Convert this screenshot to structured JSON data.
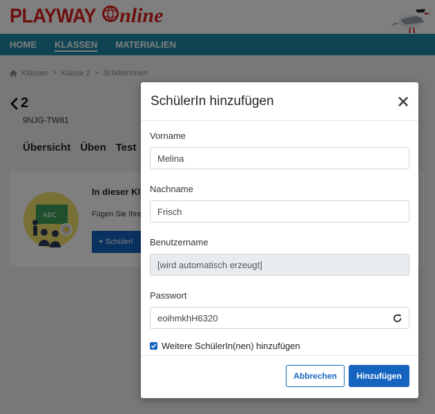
{
  "header": {
    "logo_playway": "PLAYWAY",
    "logo_online": "nline"
  },
  "nav": {
    "items": [
      {
        "label": "HOME"
      },
      {
        "label": "KLASSEN"
      },
      {
        "label": "MATERIALIEN"
      }
    ],
    "active_index": 1
  },
  "breadcrumb": {
    "items": [
      "Klassen",
      "Klasse 2",
      "SchülerInnen"
    ],
    "separator": ">"
  },
  "class_view": {
    "title": "2",
    "code": "9NJG-TW81",
    "tabs": [
      "Übersicht",
      "Üben",
      "Test"
    ],
    "card": {
      "title": "In dieser Kl",
      "text": "Fügen Sie Ihre",
      "button_label": "Schülerl"
    }
  },
  "modal": {
    "title": "SchülerIn hinzufügen",
    "fields": {
      "vorname": {
        "label": "Vorname",
        "value": "Melina"
      },
      "nachname": {
        "label": "Nachname",
        "value": "Frisch"
      },
      "benutzername": {
        "label": "Benutzername",
        "value": "[wird automatisch erzeugt]"
      },
      "passwort": {
        "label": "Passwort",
        "value": "eoihmkhH6320"
      }
    },
    "checkbox": {
      "label": "Weitere SchülerIn(nen) hinzufügen",
      "checked": true
    },
    "cancel_label": "Abbrechen",
    "submit_label": "Hinzufügen"
  },
  "colors": {
    "brand_red": "#d8201f",
    "nav_teal": "#1f8aa6",
    "primary_blue": "#1565c0"
  }
}
